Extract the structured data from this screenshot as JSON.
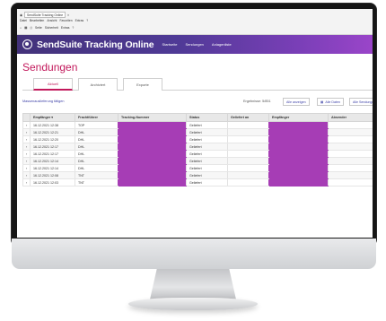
{
  "browser": {
    "tab_title": "SendSuite Tracking Online",
    "menu": [
      "Datei",
      "Bearbeiten",
      "Ansicht",
      "Favoriten",
      "Extras",
      "?"
    ],
    "tools": [
      "Seite",
      "Sicherheit",
      "Extras"
    ]
  },
  "app": {
    "title": "SendSuite Tracking Online",
    "nav": [
      "Startseite",
      "Sendungen",
      "Anlagenliste"
    ]
  },
  "page": {
    "title": "Sendungen",
    "tabs": [
      {
        "label": "Aktuell",
        "active": true
      },
      {
        "label": "Archiviert",
        "active": false
      },
      {
        "label": "Exporte",
        "active": false
      }
    ],
    "link_label": "Massenauslieferung tätigen",
    "count_label": "Ergebnisse: 5/851",
    "buttons": [
      "Alle anzeigen",
      "Alle Daten",
      "Alle Sendungen"
    ]
  },
  "table": {
    "columns": [
      "",
      "Empfänger",
      "Frachtführer",
      "Tracking-Nummer",
      "Status",
      "Geliefert an",
      "Empfänger",
      "Absender"
    ],
    "sort_column": "Empfänger",
    "rows": [
      {
        "date": "16.12.2021 12:38",
        "carrier": "TOP",
        "status": "Geliefert"
      },
      {
        "date": "16.12.2021 12:21",
        "carrier": "DHL",
        "status": "Geliefert"
      },
      {
        "date": "16.12.2021 12:20",
        "carrier": "DHL",
        "status": "Geliefert"
      },
      {
        "date": "16.12.2021 12:17",
        "carrier": "DHL",
        "status": "Geliefert"
      },
      {
        "date": "16.12.2021 12:17",
        "carrier": "DHL",
        "status": "Geliefert"
      },
      {
        "date": "16.12.2021 12:14",
        "carrier": "DHL",
        "status": "Geliefert"
      },
      {
        "date": "16.12.2021 12:14",
        "carrier": "DHL",
        "status": "Geliefert"
      },
      {
        "date": "16.12.2021 12:08",
        "carrier": "TNT",
        "status": "Geliefert"
      },
      {
        "date": "16.12.2021 12:03",
        "carrier": "TNT",
        "status": "Geliefert"
      }
    ]
  },
  "colors": {
    "accent": "#c2185b",
    "header_start": "#43327a",
    "header_end": "#9a45c9",
    "mask": "#a63db5"
  }
}
